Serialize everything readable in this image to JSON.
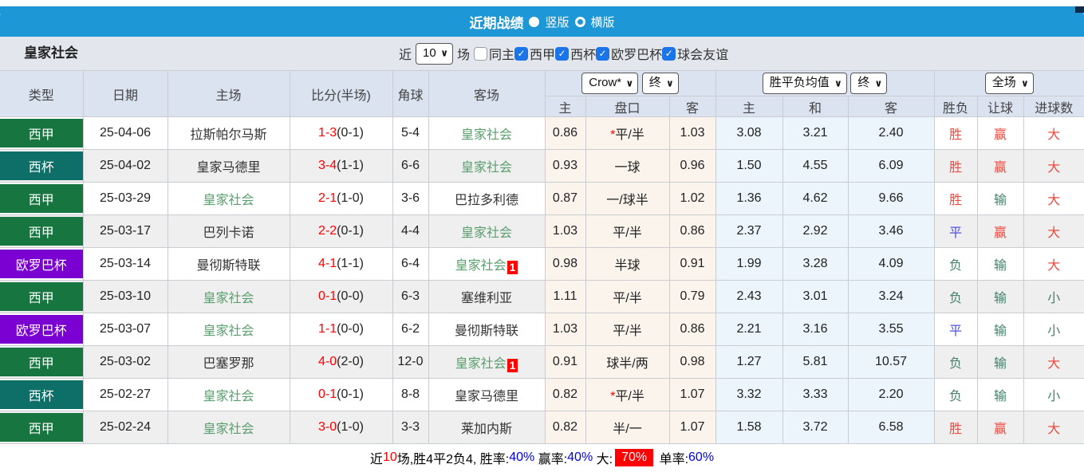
{
  "header": {
    "title": "近期战绩",
    "radio_vertical": "竖版",
    "radio_horizontal": "横版"
  },
  "filter": {
    "team": "皇家社会",
    "near_label": "近",
    "count_value": "10",
    "games_label": "场",
    "checkboxes": [
      {
        "label": "同主",
        "checked": false
      },
      {
        "label": "西甲",
        "checked": true
      },
      {
        "label": "西杯",
        "checked": true
      },
      {
        "label": "欧罗巴杯",
        "checked": true
      },
      {
        "label": "球会友谊",
        "checked": true
      }
    ]
  },
  "table": {
    "col_headers": {
      "type": "类型",
      "date": "日期",
      "home": "主场",
      "score": "比分(半场)",
      "corner": "角球",
      "away": "客场",
      "odds_home": "主",
      "odds_handicap": "盘口",
      "odds_away": "客",
      "avg_home": "主",
      "avg_draw": "和",
      "avg_away": "客",
      "result_wdl": "胜负",
      "result_handicap": "让球",
      "result_goals": "进球数"
    },
    "selects": {
      "bookmaker": "Crow*",
      "odds_state": "终",
      "avg_label": "胜平负均值",
      "avg_state": "终",
      "scope": "全场"
    },
    "team_name": "皇家社会",
    "league_colors": {
      "西甲": "#17753f",
      "西杯": "#0e6e68",
      "欧罗巴杯": "#7b00d2"
    },
    "result_colors": {
      "胜": "red",
      "平": "blue",
      "负": "green",
      "赢": "red",
      "输": "green",
      "大": "red",
      "小": "green"
    },
    "colors": {
      "red": "#ef4a3f",
      "green": "#44806a",
      "blue": "#5050e0"
    },
    "rows": [
      {
        "type": "西甲",
        "date": "25-04-06",
        "home": "拉斯帕尔马斯",
        "home_red": 0,
        "score_ft": "1-3",
        "score_ht": "(0-1)",
        "corners": "5-4",
        "away": "皇家社会",
        "away_red": 0,
        "handicap_star": true,
        "odds": [
          "0.86",
          "平/半",
          "1.03"
        ],
        "avg": [
          "3.08",
          "3.21",
          "2.40"
        ],
        "results": [
          "胜",
          "赢",
          "大"
        ]
      },
      {
        "type": "西杯",
        "date": "25-04-02",
        "home": "皇家马德里",
        "home_red": 0,
        "score_ft": "3-4",
        "score_ht": "(1-1)",
        "corners": "6-6",
        "away": "皇家社会",
        "away_red": 0,
        "handicap_star": false,
        "odds": [
          "0.93",
          "一球",
          "0.96"
        ],
        "avg": [
          "1.50",
          "4.55",
          "6.09"
        ],
        "results": [
          "胜",
          "赢",
          "大"
        ]
      },
      {
        "type": "西甲",
        "date": "25-03-29",
        "home": "皇家社会",
        "home_red": 0,
        "score_ft": "2-1",
        "score_ht": "(1-0)",
        "corners": "3-6",
        "away": "巴拉多利德",
        "away_red": 0,
        "handicap_star": false,
        "odds": [
          "0.87",
          "一/球半",
          "1.02"
        ],
        "avg": [
          "1.36",
          "4.62",
          "9.66"
        ],
        "results": [
          "胜",
          "输",
          "大"
        ]
      },
      {
        "type": "西甲",
        "date": "25-03-17",
        "home": "巴列卡诺",
        "home_red": 0,
        "score_ft": "2-2",
        "score_ht": "(0-1)",
        "corners": "4-4",
        "away": "皇家社会",
        "away_red": 0,
        "handicap_star": false,
        "odds": [
          "1.03",
          "平/半",
          "0.86"
        ],
        "avg": [
          "2.37",
          "2.92",
          "3.46"
        ],
        "results": [
          "平",
          "赢",
          "大"
        ]
      },
      {
        "type": "欧罗巴杯",
        "date": "25-03-14",
        "home": "曼彻斯特联",
        "home_red": 0,
        "score_ft": "4-1",
        "score_ht": "(1-1)",
        "corners": "6-4",
        "away": "皇家社会",
        "away_red": 1,
        "handicap_star": false,
        "odds": [
          "0.98",
          "半球",
          "0.91"
        ],
        "avg": [
          "1.99",
          "3.28",
          "4.09"
        ],
        "results": [
          "负",
          "输",
          "大"
        ]
      },
      {
        "type": "西甲",
        "date": "25-03-10",
        "home": "皇家社会",
        "home_red": 0,
        "score_ft": "0-1",
        "score_ht": "(0-0)",
        "corners": "6-3",
        "away": "塞维利亚",
        "away_red": 0,
        "handicap_star": false,
        "odds": [
          "1.11",
          "平/半",
          "0.79"
        ],
        "avg": [
          "2.43",
          "3.01",
          "3.24"
        ],
        "results": [
          "负",
          "输",
          "小"
        ]
      },
      {
        "type": "欧罗巴杯",
        "date": "25-03-07",
        "home": "皇家社会",
        "home_red": 0,
        "score_ft": "1-1",
        "score_ht": "(0-0)",
        "corners": "6-2",
        "away": "曼彻斯特联",
        "away_red": 0,
        "handicap_star": false,
        "odds": [
          "1.03",
          "平/半",
          "0.86"
        ],
        "avg": [
          "2.21",
          "3.16",
          "3.55"
        ],
        "results": [
          "平",
          "输",
          "小"
        ]
      },
      {
        "type": "西甲",
        "date": "25-03-02",
        "home": "巴塞罗那",
        "home_red": 0,
        "score_ft": "4-0",
        "score_ht": "(2-0)",
        "corners": "12-0",
        "away": "皇家社会",
        "away_red": 1,
        "handicap_star": false,
        "odds": [
          "0.91",
          "球半/两",
          "0.98"
        ],
        "avg": [
          "1.27",
          "5.81",
          "10.57"
        ],
        "results": [
          "负",
          "输",
          "大"
        ]
      },
      {
        "type": "西杯",
        "date": "25-02-27",
        "home": "皇家社会",
        "home_red": 0,
        "score_ft": "0-1",
        "score_ht": "(0-1)",
        "corners": "8-8",
        "away": "皇家马德里",
        "away_red": 0,
        "handicap_star": true,
        "odds": [
          "0.82",
          "平/半",
          "1.07"
        ],
        "avg": [
          "3.32",
          "3.33",
          "2.20"
        ],
        "results": [
          "负",
          "输",
          "小"
        ]
      },
      {
        "type": "西甲",
        "date": "25-02-24",
        "home": "皇家社会",
        "home_red": 0,
        "score_ft": "3-0",
        "score_ht": "(1-0)",
        "corners": "3-3",
        "away": "莱加内斯",
        "away_red": 0,
        "handicap_star": false,
        "odds": [
          "0.82",
          "半/一",
          "1.07"
        ],
        "avg": [
          "1.58",
          "3.72",
          "6.58"
        ],
        "results": [
          "胜",
          "赢",
          "大"
        ]
      }
    ]
  },
  "summary": {
    "segments": [
      {
        "text": "近",
        "style": "black"
      },
      {
        "text": "10",
        "style": "red"
      },
      {
        "text": "场,胜4平2负4, 胜率:",
        "style": "black"
      },
      {
        "text": "40%",
        "style": "blue"
      },
      {
        "text": " 赢率:",
        "style": "black"
      },
      {
        "text": "40%",
        "style": "blue"
      },
      {
        "text": " 大:",
        "style": "black"
      },
      {
        "text": "70%",
        "style": "redbox"
      },
      {
        "text": " 单率:",
        "style": "black"
      },
      {
        "text": "60%",
        "style": "blue"
      }
    ]
  }
}
